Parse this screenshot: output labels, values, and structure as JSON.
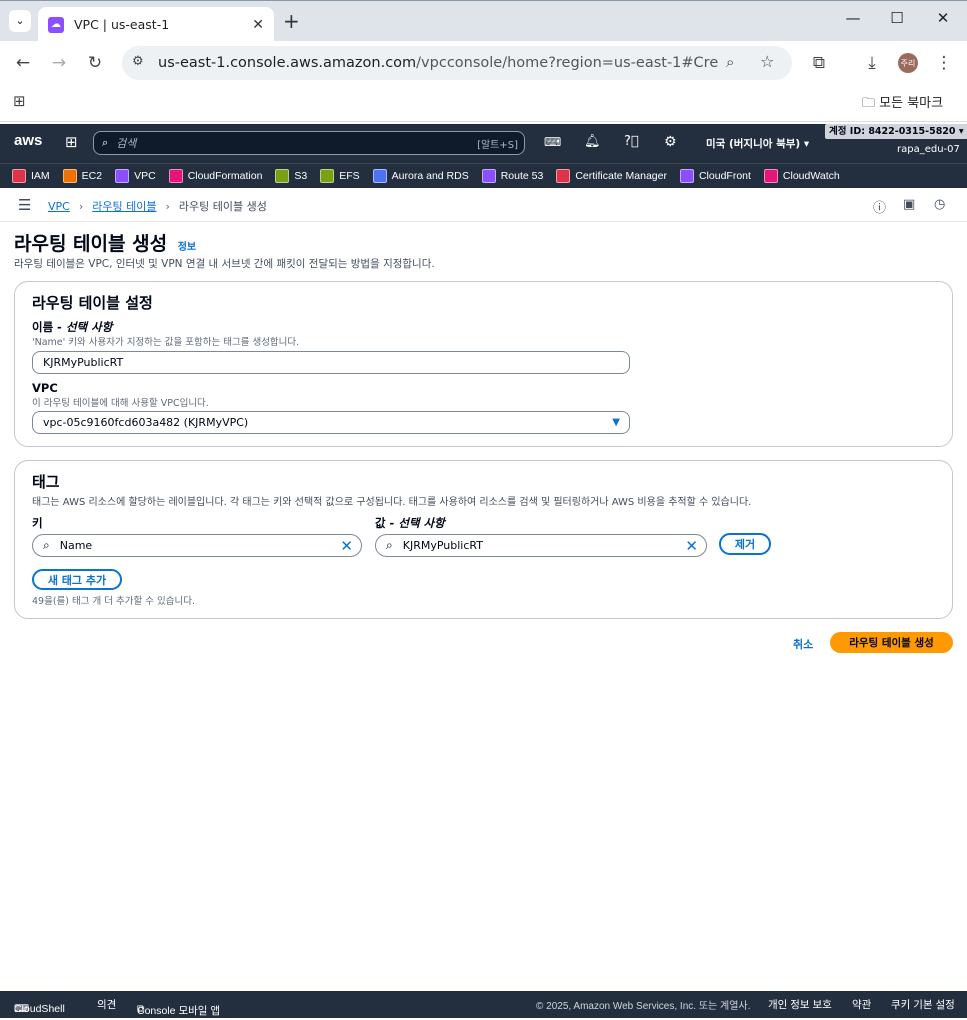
{
  "browser": {
    "tab_title": "VPC | us-east-1",
    "url_main": "us-east-1.console.aws.amazon.com",
    "url_rest": "/vpcconsole/home?region=us-east-1#CreateRoute...",
    "profile_label": "주리",
    "bookmarks_label": "모든 북마크"
  },
  "aws_nav": {
    "logo": "aws",
    "search_placeholder": "검색",
    "search_shortcut": "[알트+S]",
    "region": "미국 (버지니아 북부) ▾",
    "account_id": "계정 ID: 8422-0315-5820 ▾",
    "user": "rapa_edu-07"
  },
  "services": [
    {
      "label": "IAM",
      "color": "#dd344c"
    },
    {
      "label": "EC2",
      "color": "#ed7100"
    },
    {
      "label": "VPC",
      "color": "#8c4fff"
    },
    {
      "label": "CloudFormation",
      "color": "#e7157b"
    },
    {
      "label": "S3",
      "color": "#7aa116"
    },
    {
      "label": "EFS",
      "color": "#7aa116"
    },
    {
      "label": "Aurora and RDS",
      "color": "#4d72f3"
    },
    {
      "label": "Route 53",
      "color": "#8c4fff"
    },
    {
      "label": "Certificate Manager",
      "color": "#dd344c"
    },
    {
      "label": "CloudFront",
      "color": "#8c4fff"
    },
    {
      "label": "CloudWatch",
      "color": "#e7157b"
    }
  ],
  "breadcrumb": {
    "item1": "VPC",
    "item2": "라우팅 테이블",
    "current": "라우팅 테이블 생성"
  },
  "page": {
    "title": "라우팅 테이블 생성",
    "info": "정보",
    "description": "라우팅 테이블은 VPC, 인터넷 및 VPN 연결 내 서브넷 간에 패킷이 전달되는 방법을 지정합니다."
  },
  "settings": {
    "heading": "라우팅 테이블 설정",
    "name_label": "이름",
    "name_optional": " - 선택 사항",
    "name_desc": "'Name' 키와 사용자가 지정하는 값을 포함하는 태그를 생성합니다.",
    "name_value": "KJRMyPublicRT",
    "vpc_label": "VPC",
    "vpc_desc": "이 라우팅 테이블에 대해 사용할 VPC입니다.",
    "vpc_value": "vpc-05c9160fcd603a482 (KJRMyVPC)"
  },
  "tags": {
    "heading": "태그",
    "desc": "태그는 AWS 리소스에 할당하는 레이블입니다. 각 태그는 키와 선택적 값으로 구성됩니다. 태그를 사용하여 리소스를 검색 및 필터링하거나 AWS 비용을 추적할 수 있습니다.",
    "key_label": "키",
    "value_label": "값",
    "value_optional": " - 선택 사항",
    "key_value": "Name",
    "value_value": "KJRMyPublicRT",
    "remove_label": "제거",
    "add_label": "새 태그 추가",
    "remaining": "49을(를) 태그 개 더 추가할 수 있습니다."
  },
  "actions": {
    "cancel": "취소",
    "create": "라우팅 테이블 생성"
  },
  "footer": {
    "cloudshell": "CloudShell",
    "feedback": "의견",
    "mobile": "Console 모바일 앱",
    "copyright": "© 2025, Amazon Web Services, Inc. 또는 계열사.",
    "privacy": "개인 정보 보호",
    "terms": "약관",
    "cookies": "쿠키 기본 설정"
  }
}
